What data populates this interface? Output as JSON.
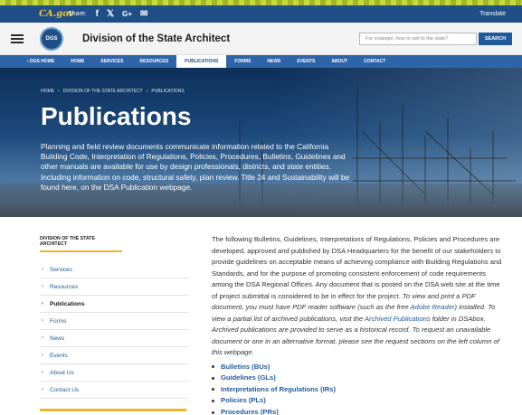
{
  "ca_bar": {
    "logo_text": "CA.gov",
    "share_label": "Share:",
    "social_icons": [
      "facebook-icon",
      "x-icon",
      "google-plus-icon",
      "email-icon"
    ],
    "translate_label": "Translate"
  },
  "header": {
    "site_title": "Division of the State Architect",
    "search_placeholder": "For example, how to sell to the state?",
    "search_button": "SEARCH"
  },
  "nav": {
    "items": [
      {
        "label": "‹ DGS HOME",
        "active": false
      },
      {
        "label": "HOME",
        "active": false
      },
      {
        "label": "SERVICES",
        "active": false
      },
      {
        "label": "RESOURCES",
        "active": false
      },
      {
        "label": "PUBLICATIONS",
        "active": true
      },
      {
        "label": "FORMS",
        "active": false
      },
      {
        "label": "NEWS",
        "active": false
      },
      {
        "label": "EVENTS",
        "active": false
      },
      {
        "label": "ABOUT",
        "active": false
      },
      {
        "label": "CONTACT",
        "active": false
      }
    ]
  },
  "hero": {
    "breadcrumb": [
      "HOME",
      "›",
      "DIVISION OF THE STATE ARCHITECT",
      "›",
      "PUBLICATIONS"
    ],
    "title": "Publications",
    "description": "Planning and field review documents communicate information related to the California Building Code, Interpretation of Regulations, Policies, Procedures, Bulletins, Guidelines and other manuals are available for use by design professionals, districts, and state entities. Including information on code, structural safety, plan review. Title 24 and Sustainability will be found here, on the DSA Publication webpage."
  },
  "sidebar": {
    "heading": "DIVISION OF THE STATE ARCHITECT",
    "items": [
      {
        "label": "Services",
        "active": false
      },
      {
        "label": "Resources",
        "active": false
      },
      {
        "label": "Publications",
        "active": true
      },
      {
        "label": "Forms",
        "active": false
      },
      {
        "label": "News",
        "active": false
      },
      {
        "label": "Events",
        "active": false
      },
      {
        "label": "About Us",
        "active": false
      },
      {
        "label": "Contact Us",
        "active": false
      }
    ]
  },
  "content": {
    "intro_plain": "The following Bulletins, Guidelines, Interpretations of Regulations, Policies and Procedures are developed, approved and published by DSA Headquarters for the benefit of our stakeholders to provide guidelines on acceptable means of achieving compliance with Building Regulations and Standards, and for the purpose of promoting consistent enforcement of code requirements among the DSA Regional Offices. Any document that is posted on the DSA web site at the time of project submittal is considered to be in effect for the project. ",
    "intro_italic_1": "To view and print a PDF document, you must have PDF reader software (such as the free ",
    "adobe_link": "Adobe Reader",
    "intro_italic_2": ") installed. To view a partial list of archived publications, visit the ",
    "archived_link": "Archived Publications",
    "intro_italic_3": " folder in DSAbox. Archived publications are provided to serve as a historical record. To request an unavailable document or one in an alternative format, please see the request sections on the left column of this webpage.",
    "links": [
      "Bulletins (BUs)",
      "Guidelines (GLs)",
      "Interpretations of Regulations (IRs)",
      "Policies (PLs)",
      "Procedures (PRs)"
    ]
  },
  "colors": {
    "top_bar": "#1f4f86",
    "nav": "#2e64a8",
    "accent": "#f0b429",
    "link": "#1e5a9c"
  }
}
